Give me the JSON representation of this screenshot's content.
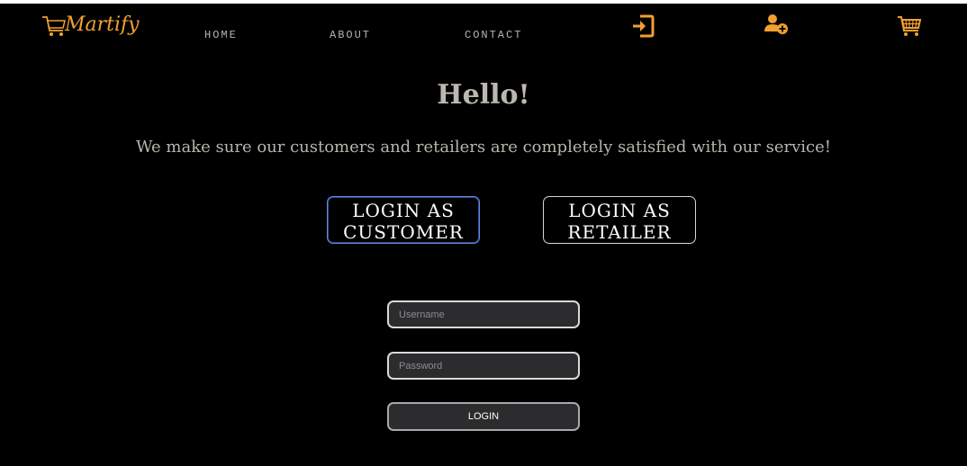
{
  "brand": {
    "logo_text": "Martify",
    "accent_color": "#f0a030"
  },
  "nav": {
    "links": [
      "HOME",
      "ABOUT",
      "CONTACT"
    ],
    "icons": [
      "login-icon",
      "add-user-icon",
      "cart-icon"
    ]
  },
  "hero": {
    "title": "Hello!",
    "subtitle": "We make sure our customers and retailers are completely satisfied with our service!"
  },
  "roles": {
    "customer_line1": "LOGIN AS",
    "customer_line2": "CUSTOMER",
    "retailer_line1": "LOGIN AS",
    "retailer_line2": "RETAILER"
  },
  "form": {
    "username_placeholder": "Username",
    "password_placeholder": "Password",
    "submit_label": "LOGIN"
  }
}
